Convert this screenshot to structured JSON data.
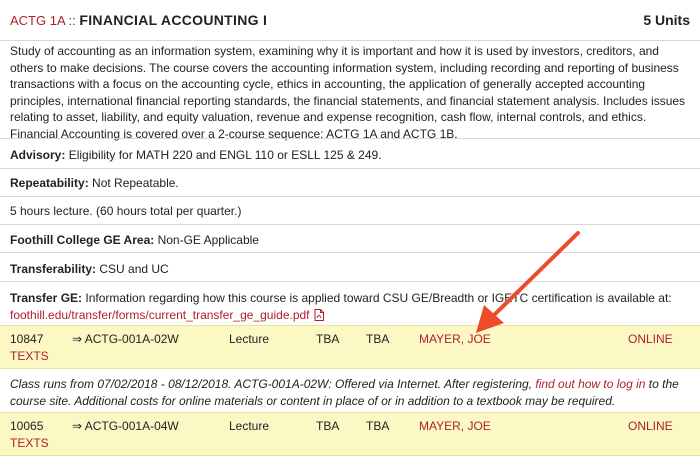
{
  "course": {
    "code": "ACTG 1A",
    "separator": " :: ",
    "title": "FINANCIAL ACCOUNTING I",
    "units": "5 Units"
  },
  "description": "Study of accounting as an information system, examining why it is important and how it is used by investors, creditors, and others to make decisions. The course covers the accounting information system, including recording and reporting of business transactions with a focus on the accounting cycle, ethics in accounting, the application of generally accepted accounting principles, international financial reporting standards, the financial statements, and financial statement analysis. Includes issues relating to asset, liability, and equity valuation, revenue and expense recognition, cash flow, internal controls, and ethics. Financial Accounting is covered over a 2-course sequence: ACTG 1A and ACTG 1B.",
  "advisory": {
    "label": "Advisory:",
    "value": " Eligibility for MATH 220 and ENGL 110 or ESLL 125 & 249."
  },
  "repeatability": {
    "label": "Repeatability:",
    "value": " Not Repeatable."
  },
  "hours": "5 hours lecture. (60 hours total per quarter.)",
  "ge_area": {
    "label": "Foothill College GE Area:",
    "value": " Non-GE Applicable"
  },
  "transferability": {
    "label": "Transferability:",
    "value": " CSU and UC"
  },
  "transfer_ge": {
    "label": "Transfer GE:",
    "value": " Information regarding how this course is applied toward CSU GE/Breadth or IGETC certification is available at:",
    "link": "foothill.edu/transfer/forms/current_transfer_ge_guide.pdf"
  },
  "sections": [
    {
      "crn": "10847",
      "section": "⇒ ACTG-001A-02W",
      "type": "Lecture",
      "days": "TBA",
      "time": "TBA",
      "instructor": "MAYER, JOE",
      "location": "ONLINE",
      "texts": "TEXTS"
    },
    {
      "crn": "10065",
      "section": "⇒ ACTG-001A-04W",
      "type": "Lecture",
      "days": "TBA",
      "time": "TBA",
      "instructor": "MAYER, JOE",
      "location": "ONLINE",
      "texts": "TEXTS"
    }
  ],
  "section_note": {
    "before": "Class runs from 07/02/2018 - 08/12/2018. ACTG-001A-02W: Offered via Internet. After registering, ",
    "link": "find out how to log in",
    "after": " to the course site. Additional costs for online materials or content in place of or in addition to a textbook may be required."
  },
  "colors": {
    "accent": "#b11e2d",
    "row_highlight": "#fbf8c4",
    "annotation_arrow": "#ee4b2b"
  },
  "icons": {
    "pdf": "pdf-icon",
    "arrow": "annotation-arrow"
  }
}
